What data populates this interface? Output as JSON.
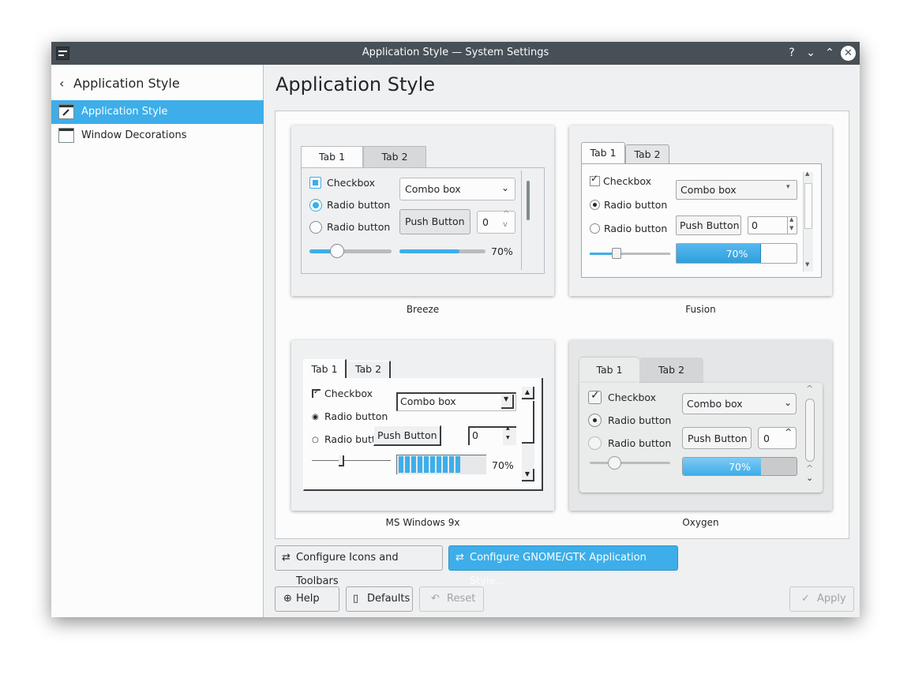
{
  "window": {
    "title": "Application Style — System Settings",
    "controls": {
      "help": "?",
      "minimize": "⌄",
      "maximize": "⌃",
      "close": "✕"
    }
  },
  "sidebar": {
    "back_label": "Application Style",
    "items": [
      {
        "label": "Application Style",
        "icon": "app-style-icon",
        "selected": true
      },
      {
        "label": "Window Decorations",
        "icon": "window-decorations-icon",
        "selected": false
      }
    ]
  },
  "main": {
    "title": "Application Style",
    "styles": [
      {
        "name": "Breeze",
        "tab1": "Tab 1",
        "tab2": "Tab 2",
        "checkbox": "Checkbox",
        "radio1": "Radio button",
        "radio2": "Radio button",
        "combo": "Combo box",
        "push": "Push Button",
        "spin": "0",
        "progress": "70%"
      },
      {
        "name": "Fusion",
        "tab1": "Tab 1",
        "tab2": "Tab 2",
        "checkbox": "Checkbox",
        "radio1": "Radio button",
        "radio2": "Radio button",
        "combo": "Combo box",
        "push": "Push Button",
        "spin": "0",
        "progress": "70%"
      },
      {
        "name": "MS Windows 9x",
        "tab1": "Tab 1",
        "tab2": "Tab 2",
        "checkbox": "Checkbox",
        "radio1": "Radio button",
        "radio2": "Radio button",
        "combo": "Combo box",
        "push": "Push Button",
        "spin": "0",
        "progress": "70%"
      },
      {
        "name": "Oxygen",
        "tab1": "Tab 1",
        "tab2": "Tab 2",
        "checkbox": "Checkbox",
        "radio1": "Radio button",
        "radio2": "Radio button",
        "combo": "Combo box",
        "push": "Push Button",
        "spin": "0",
        "progress": "70%"
      }
    ],
    "configure_icons_button": "Configure Icons and Toolbars",
    "configure_gtk_button": "Configure GNOME/GTK Application Style..."
  },
  "footer": {
    "help": "Help",
    "defaults": "Defaults",
    "reset": "Reset",
    "apply": "Apply"
  },
  "colors": {
    "accent": "#3daee9",
    "titlebar": "#475057",
    "window_bg": "#eff0f1"
  }
}
